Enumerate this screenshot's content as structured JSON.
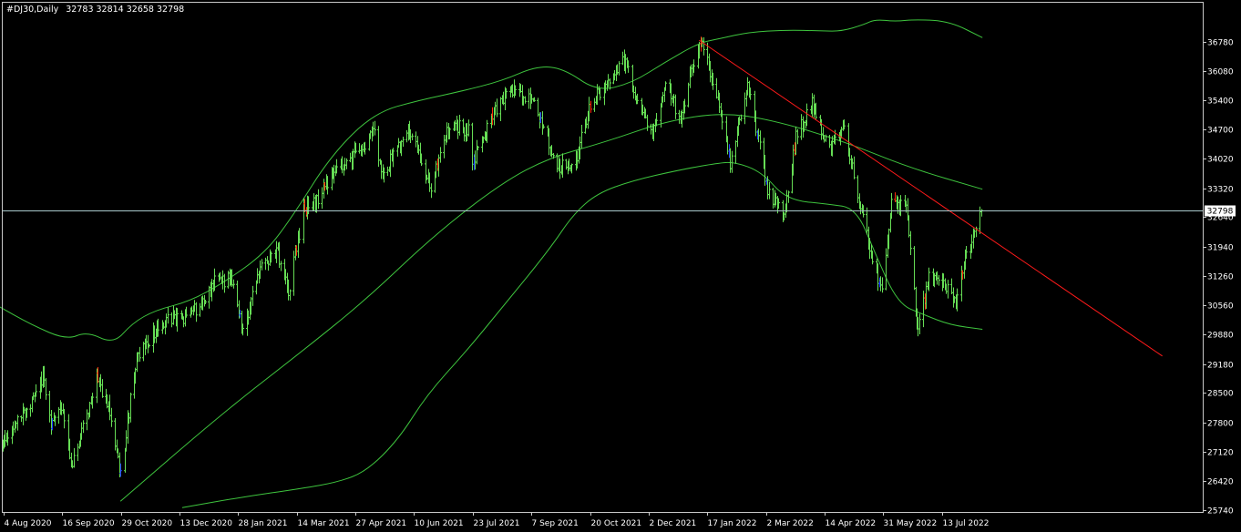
{
  "header": {
    "symbol_timeframe": "#DJ30,Daily",
    "ohlc": "32783 32814 32658 32798"
  },
  "current_price_label": "32798",
  "colors": {
    "background": "#000000",
    "frame": "#c8c8c8",
    "bar_up": "#66dd55",
    "bar_red": "#ff2a0a",
    "bar_blue": "#1e3cff",
    "bands": "#3ec43e",
    "trendline": "#ff1a1a",
    "price_line": "#a8c8cc",
    "price_tag_bg": "#ffffff"
  },
  "chart_data": {
    "type": "ohlc-bar",
    "ylim": [
      25740,
      37070
    ],
    "y_ticks": [
      "36780",
      "36080",
      "35400",
      "34700",
      "34020",
      "33320",
      "32640",
      "31940",
      "31260",
      "30560",
      "29880",
      "29180",
      "28500",
      "27800",
      "27120",
      "26420",
      "25740"
    ],
    "x_tick_labels": [
      "4 Aug 2020",
      "16 Sep 2020",
      "29 Oct 2020",
      "13 Dec 2020",
      "28 Jan 2021",
      "14 Mar 2021",
      "27 Apr 2021",
      "10 Jun 2021",
      "23 Jul 2021",
      "7 Sep 2021",
      "20 Oct 2021",
      "2 Dec 2021",
      "17 Jan 2022",
      "2 Mar 2022",
      "14 Apr 2022",
      "31 May 2022",
      "13 Jul 2022"
    ],
    "close_anchors": [
      [
        "2020-07-28",
        26900
      ],
      [
        "2020-08-04",
        27300
      ],
      [
        "2020-08-14",
        27900
      ],
      [
        "2020-08-25",
        28250
      ],
      [
        "2020-09-02",
        28900
      ],
      [
        "2020-09-08",
        27800
      ],
      [
        "2020-09-16",
        28100
      ],
      [
        "2020-09-23",
        26800
      ],
      [
        "2020-10-02",
        27700
      ],
      [
        "2020-10-12",
        28800
      ],
      [
        "2020-10-20",
        28300
      ],
      [
        "2020-10-30",
        26500
      ],
      [
        "2020-11-06",
        28300
      ],
      [
        "2020-11-12",
        29400
      ],
      [
        "2020-11-25",
        30000
      ],
      [
        "2020-12-04",
        30200
      ],
      [
        "2020-12-21",
        30300
      ],
      [
        "2021-01-08",
        31100
      ],
      [
        "2021-01-20",
        31200
      ],
      [
        "2021-01-29",
        30000
      ],
      [
        "2021-02-12",
        31500
      ],
      [
        "2021-02-24",
        31800
      ],
      [
        "2021-03-04",
        30900
      ],
      [
        "2021-03-15",
        32800
      ],
      [
        "2021-03-26",
        33100
      ],
      [
        "2021-04-09",
        33800
      ],
      [
        "2021-04-20",
        34000
      ],
      [
        "2021-05-07",
        34700
      ],
      [
        "2021-05-12",
        33600
      ],
      [
        "2021-05-25",
        34300
      ],
      [
        "2021-06-04",
        34700
      ],
      [
        "2021-06-18",
        33300
      ],
      [
        "2021-07-02",
        34800
      ],
      [
        "2021-07-16",
        34700
      ],
      [
        "2021-07-19",
        33900
      ],
      [
        "2021-08-06",
        35200
      ],
      [
        "2021-08-16",
        35600
      ],
      [
        "2021-09-03",
        35400
      ],
      [
        "2021-09-20",
        33800
      ],
      [
        "2021-10-04",
        34000
      ],
      [
        "2021-10-15",
        35300
      ],
      [
        "2021-10-26",
        35800
      ],
      [
        "2021-11-08",
        36400
      ],
      [
        "2021-11-30",
        34500
      ],
      [
        "2021-12-10",
        35900
      ],
      [
        "2021-12-20",
        34900
      ],
      [
        "2021-12-31",
        36300
      ],
      [
        "2022-01-04",
        36800
      ],
      [
        "2022-01-14",
        35900
      ],
      [
        "2022-01-27",
        33900
      ],
      [
        "2022-02-09",
        35800
      ],
      [
        "2022-02-24",
        33300
      ],
      [
        "2022-03-08",
        32700
      ],
      [
        "2022-03-17",
        34500
      ],
      [
        "2022-03-29",
        35300
      ],
      [
        "2022-04-12",
        34200
      ],
      [
        "2022-04-21",
        34800
      ],
      [
        "2022-05-02",
        33200
      ],
      [
        "2022-05-12",
        31800
      ],
      [
        "2022-05-20",
        30900
      ],
      [
        "2022-05-27",
        32900
      ],
      [
        "2022-06-07",
        33000
      ],
      [
        "2022-06-16",
        29900
      ],
      [
        "2022-06-24",
        31300
      ],
      [
        "2022-07-05",
        31100
      ],
      [
        "2022-07-14",
        30700
      ],
      [
        "2022-07-22",
        31900
      ],
      [
        "2022-07-27",
        32200
      ],
      [
        "2022-08-02",
        32798
      ]
    ],
    "bollinger_upper_anchors": [
      [
        "2020-07-28",
        30600
      ],
      [
        "2020-08-25",
        30100
      ],
      [
        "2020-09-20",
        29750
      ],
      [
        "2020-10-05",
        29950
      ],
      [
        "2020-10-25",
        29650
      ],
      [
        "2020-11-08",
        30150
      ],
      [
        "2020-11-25",
        30450
      ],
      [
        "2020-12-20",
        30650
      ],
      [
        "2021-01-15",
        31100
      ],
      [
        "2021-02-15",
        31800
      ],
      [
        "2021-03-08",
        32700
      ],
      [
        "2021-04-05",
        34100
      ],
      [
        "2021-05-07",
        35100
      ],
      [
        "2021-06-10",
        35400
      ],
      [
        "2021-07-10",
        35600
      ],
      [
        "2021-08-10",
        35850
      ],
      [
        "2021-09-05",
        36200
      ],
      [
        "2021-09-25",
        36150
      ],
      [
        "2021-10-20",
        35600
      ],
      [
        "2021-11-15",
        35800
      ],
      [
        "2021-12-10",
        36300
      ],
      [
        "2022-01-04",
        36750
      ],
      [
        "2022-01-20",
        36850
      ],
      [
        "2022-02-10",
        37000
      ],
      [
        "2022-03-10",
        37050
      ],
      [
        "2022-04-05",
        37030
      ],
      [
        "2022-04-20",
        37020
      ],
      [
        "2022-05-07",
        37180
      ],
      [
        "2022-05-15",
        37300
      ],
      [
        "2022-05-30",
        37250
      ],
      [
        "2022-06-15",
        37300
      ],
      [
        "2022-07-10",
        37250
      ],
      [
        "2022-08-03",
        36870
      ]
    ],
    "bollinger_middle_anchors": [
      [
        "2020-10-30",
        25950
      ],
      [
        "2021-01-15",
        28050
      ],
      [
        "2021-03-15",
        29500
      ],
      [
        "2021-05-01",
        30700
      ],
      [
        "2021-06-20",
        32200
      ],
      [
        "2021-08-10",
        33450
      ],
      [
        "2021-09-15",
        34050
      ],
      [
        "2021-10-25",
        34400
      ],
      [
        "2021-12-10",
        34900
      ],
      [
        "2022-01-20",
        35100
      ],
      [
        "2022-02-25",
        34950
      ],
      [
        "2022-04-20",
        34450
      ],
      [
        "2022-06-10",
        33800
      ],
      [
        "2022-08-03",
        33300
      ]
    ],
    "bollinger_lower_anchors": [
      [
        "2020-12-15",
        25800
      ],
      [
        "2021-01-29",
        26050
      ],
      [
        "2021-03-14",
        26250
      ],
      [
        "2021-04-10",
        26400
      ],
      [
        "2021-05-01",
        26650
      ],
      [
        "2021-05-25",
        27400
      ],
      [
        "2021-06-15",
        28450
      ],
      [
        "2021-07-15",
        29500
      ],
      [
        "2021-08-10",
        30500
      ],
      [
        "2021-09-15",
        31900
      ],
      [
        "2021-10-02",
        32700
      ],
      [
        "2021-10-20",
        33200
      ],
      [
        "2021-11-15",
        33500
      ],
      [
        "2021-12-20",
        33750
      ],
      [
        "2022-01-15",
        33900
      ],
      [
        "2022-01-30",
        33950
      ],
      [
        "2022-02-20",
        33700
      ],
      [
        "2022-03-10",
        33050
      ],
      [
        "2022-04-10",
        32950
      ],
      [
        "2022-05-01",
        32850
      ],
      [
        "2022-05-15",
        31800
      ],
      [
        "2022-06-01",
        30600
      ],
      [
        "2022-06-20",
        30350
      ],
      [
        "2022-07-10",
        30100
      ],
      [
        "2022-08-03",
        30000
      ]
    ],
    "trendline": {
      "start": [
        "2022-01-04",
        36810
      ],
      "end": [
        "2022-12-15",
        29370
      ]
    },
    "current_price": 32798
  }
}
